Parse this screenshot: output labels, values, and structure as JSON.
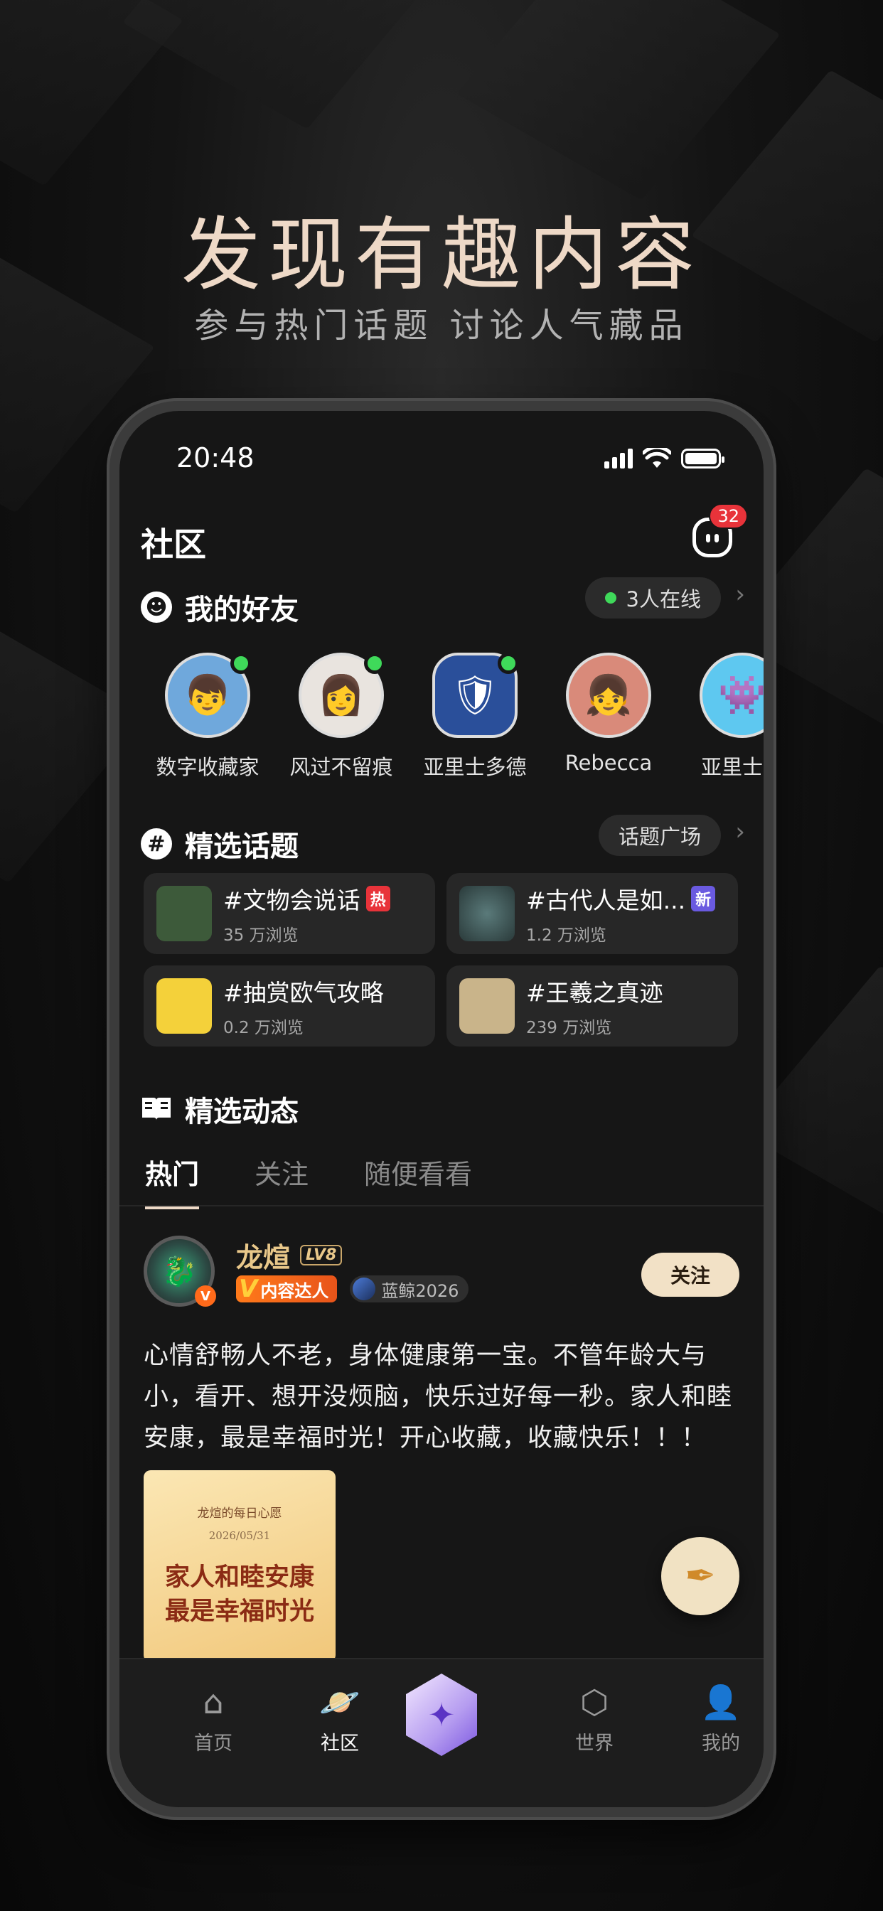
{
  "promo": {
    "headline": "发现有趣内容",
    "subheadline": "参与热门话题 讨论人气藏品"
  },
  "status_bar": {
    "time": "20:48"
  },
  "header": {
    "title": "社区",
    "message_badge": "32",
    "message_icon": "robot-face-icon"
  },
  "friends": {
    "title": "我的好友",
    "online_label": "3人在线",
    "items": [
      {
        "name": "数字收藏家",
        "online": true
      },
      {
        "name": "风过不留痕",
        "online": true
      },
      {
        "name": "亚里士多德",
        "online": true
      },
      {
        "name": "Rebecca",
        "online": false
      },
      {
        "name": "亚里士多",
        "online": false
      }
    ]
  },
  "topics": {
    "title": "精选话题",
    "plaza_label": "话题广场",
    "items": [
      {
        "title": "#文物会说话",
        "tag": "热",
        "tag_color": "#e8333a",
        "views": "35 万浏览",
        "thumb_color": "#3d5a3a"
      },
      {
        "title": "#古代人是如...",
        "tag": "新",
        "tag_color": "#6a5ae0",
        "views": "1.2 万浏览",
        "thumb_color": "#3a4a52"
      },
      {
        "title": "#抽赏欧气攻略",
        "tag": "",
        "tag_color": "",
        "views": "0.2 万浏览",
        "thumb_color": "#f4d13a"
      },
      {
        "title": "#王羲之真迹",
        "tag": "",
        "tag_color": "",
        "views": "239 万浏览",
        "thumb_color": "#c9b48a"
      }
    ]
  },
  "feed": {
    "title": "精选动态",
    "tabs": [
      "热门",
      "关注",
      "随便看看"
    ],
    "active_tab": 0
  },
  "post": {
    "username": "龙煊",
    "level": "LV8",
    "v_label": "内容达人",
    "collection_label": "蓝鲸2026",
    "follow_label": "关注",
    "text": "心情舒畅人不老，身体健康第一宝。不管年龄大与小，看开、想开没烦脑，快乐过好每一秒。家人和睦安康，最是幸福时光！开心收藏，收藏快乐！！！",
    "image": {
      "caption": "龙煊的每日心愿",
      "date": "2026/05/31",
      "line1": "家人和睦安康",
      "line2": "最是幸福时光"
    }
  },
  "nav": {
    "items": [
      {
        "label": "首页",
        "icon": "home-icon"
      },
      {
        "label": "社区",
        "icon": "planet-icon"
      },
      {
        "label": "",
        "icon": "create-hexagon-icon"
      },
      {
        "label": "世界",
        "icon": "box-icon"
      },
      {
        "label": "我的",
        "icon": "user-icon"
      }
    ],
    "active": 1
  },
  "colors": {
    "accent_gold": "#eed9c7",
    "online_green": "#3fd95a",
    "hot_red": "#e8333a",
    "new_purple": "#6a5ae0"
  }
}
